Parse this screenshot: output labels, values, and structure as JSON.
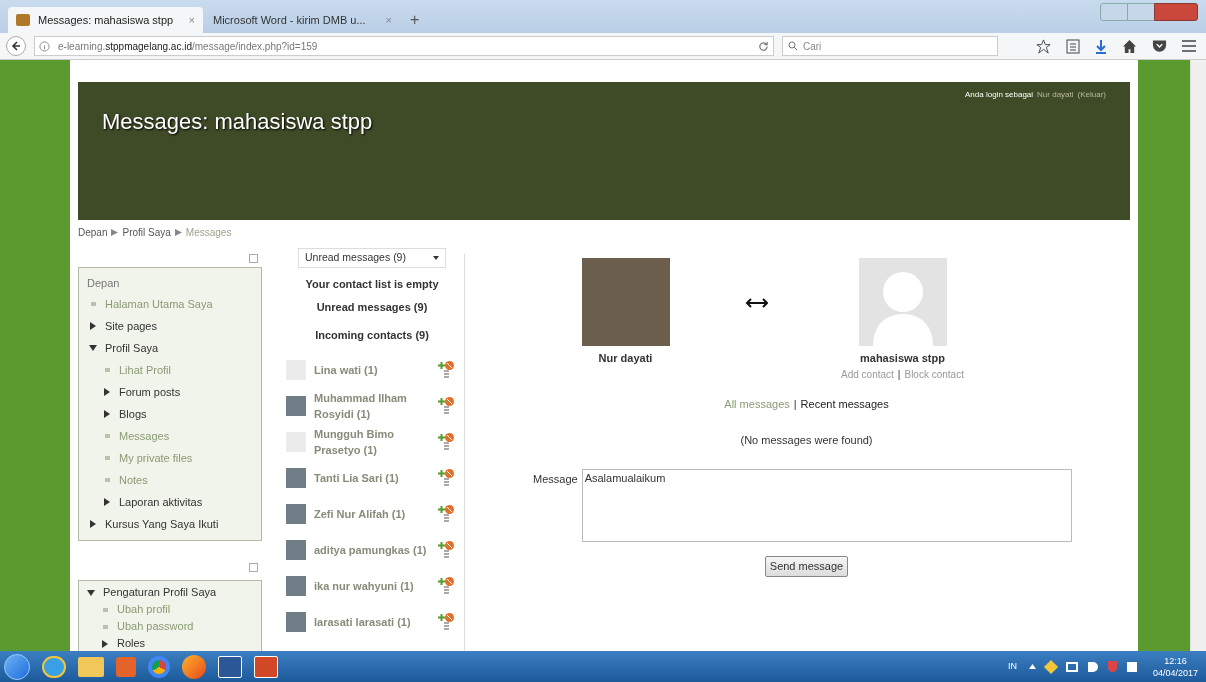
{
  "browser": {
    "tabs": [
      {
        "title": "Messages: mahasiswa stpp",
        "close": "×",
        "selected": true
      },
      {
        "title": "Microsoft Word - kirim DMB u...",
        "close": "×",
        "selected": false
      }
    ],
    "new_tab": "+",
    "url": "e-learning.**stppmagelang.ac.id**/message/index.php?id=159",
    "search": {
      "placeholder": "Cari"
    }
  },
  "header": {
    "title": "Messages: mahasiswa stpp",
    "login_text": "Anda login sebagai",
    "user": "Nur dayati",
    "logout": "(Keluar)"
  },
  "breadcrumb": [
    {
      "label": "Depan",
      "current": false
    },
    {
      "label": "Profil Saya",
      "current": false
    },
    {
      "label": "Messages",
      "current": true
    }
  ],
  "navigation": {
    "root": "Depan",
    "items": [
      {
        "label": "Halaman Utama Saya",
        "kind": "leaf"
      },
      {
        "label": "Site pages",
        "kind": "branch",
        "expanded": false
      },
      {
        "label": "Profil Saya",
        "kind": "branch",
        "expanded": true,
        "children": [
          {
            "label": "Lihat Profil",
            "kind": "leaf"
          },
          {
            "label": "Forum posts",
            "kind": "branch",
            "expanded": false
          },
          {
            "label": "Blogs",
            "kind": "branch",
            "expanded": false
          },
          {
            "label": "Messages",
            "kind": "leaf"
          },
          {
            "label": "My private files",
            "kind": "leaf"
          },
          {
            "label": "Notes",
            "kind": "leaf"
          },
          {
            "label": "Laporan aktivitas",
            "kind": "branch",
            "expanded": false
          }
        ]
      },
      {
        "label": "Kursus Yang Saya Ikuti",
        "kind": "branch",
        "expanded": false
      }
    ]
  },
  "settings": {
    "items": [
      {
        "label": "Pengaturan Profil Saya",
        "kind": "branch",
        "expanded": true,
        "children": [
          {
            "label": "Ubah profil",
            "kind": "leaf"
          },
          {
            "label": "Ubah password",
            "kind": "leaf"
          },
          {
            "label": "Roles",
            "kind": "branch",
            "expanded": false
          }
        ]
      }
    ]
  },
  "contacts": {
    "view": "Unread messages (9)",
    "empty": "Your contact list is empty",
    "unread_heading": "Unread messages (9)",
    "incoming_heading": "Incoming contacts (9)",
    "list": [
      {
        "name": "Lina wati (1)",
        "kind": "default"
      },
      {
        "name": "Muhammad Ilham Rosyidi (1)",
        "kind": "photo"
      },
      {
        "name": "Mungguh Bimo Prasetyo (1)",
        "kind": "default"
      },
      {
        "name": "Tanti Lia Sari (1)",
        "kind": "photo"
      },
      {
        "name": "Zefi Nur Alifah (1)",
        "kind": "photo"
      },
      {
        "name": "aditya pamungkas (1)",
        "kind": "photo"
      },
      {
        "name": "ika nur wahyuni (1)",
        "kind": "photo"
      },
      {
        "name": "larasati larasati (1)",
        "kind": "photo"
      }
    ]
  },
  "conversation": {
    "separator": "|",
    "me": "Nur dayati",
    "other": "mahasiswa stpp",
    "add_contact": "Add contact",
    "block_contact": "Block contact",
    "views": [
      {
        "label": "All messages",
        "selected": false
      },
      {
        "label": "Recent messages",
        "selected": true
      }
    ],
    "empty": "(No messages were found)",
    "message_label": "Message",
    "message_value": "Asalamualaikum",
    "send": "Send message"
  },
  "taskbar": {
    "language": "IN",
    "time": "12:16",
    "date": "04/04/2017"
  }
}
